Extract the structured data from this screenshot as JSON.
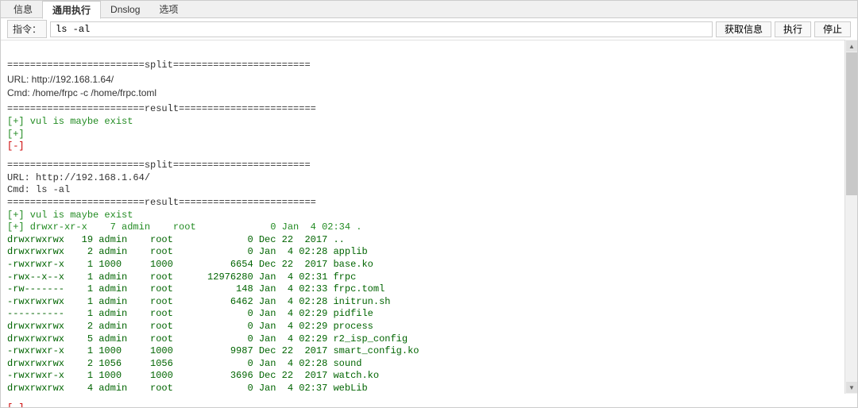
{
  "tabs": {
    "info": "信息",
    "exec": "通用执行",
    "dnslog": "Dnslog",
    "options": "选项"
  },
  "command_bar": {
    "label": "指令：",
    "value": "ls -al",
    "btn_getinfo": "获取信息",
    "btn_exec": "执行",
    "btn_stop": "停止"
  },
  "output": {
    "split_header1": "========================split========================",
    "url1": "URL: http://192.168.1.64/",
    "cmd1": "Cmd: /home/frpc -c /home/frpc.toml",
    "result_header1": "========================result========================",
    "vul_exist1": "[+] vul is maybe exist",
    "plus1": "[+]",
    "minus1": "[-]",
    "split_header2": "========================split========================",
    "url2": "URL: http://192.168.1.64/",
    "cmd2": "Cmd: ls -al",
    "result_header2": "========================result========================",
    "vul_exist2": "[+] vul is maybe exist",
    "ls_line1": "[+] drwxr-xr-x    7 admin    root             0 Jan  4 02:34 .",
    "ls_rows": [
      "drwxrwxrwx   19 admin    root             0 Dec 22  2017 ..",
      "drwxrwxrwx    2 admin    root             0 Jan  4 02:28 applib",
      "-rwxrwxr-x    1 1000     1000          6654 Dec 22  2017 base.ko",
      "-rwx--x--x    1 admin    root      12976280 Jan  4 02:31 frpc",
      "-rw-------    1 admin    root           148 Jan  4 02:33 frpc.toml",
      "-rwxrwxrwx    1 admin    root          6462 Jan  4 02:28 initrun.sh",
      "----------    1 admin    root             0 Jan  4 02:29 pidfile",
      "drwxrwxrwx    2 admin    root             0 Jan  4 02:29 process",
      "drwxrwxrwx    5 admin    root             0 Jan  4 02:29 r2_isp_config",
      "-rwxrwxr-x    1 1000     1000          9987 Dec 22  2017 smart_config.ko",
      "drwxrwxrwx    2 1056     1056             0 Jan  4 02:28 sound",
      "-rwxrwxr-x    1 1000     1000          3696 Dec 22  2017 watch.ko",
      "drwxrwxrwx    4 admin    root             0 Jan  4 02:37 webLib"
    ],
    "plus2": "",
    "minus2": "[-]"
  }
}
